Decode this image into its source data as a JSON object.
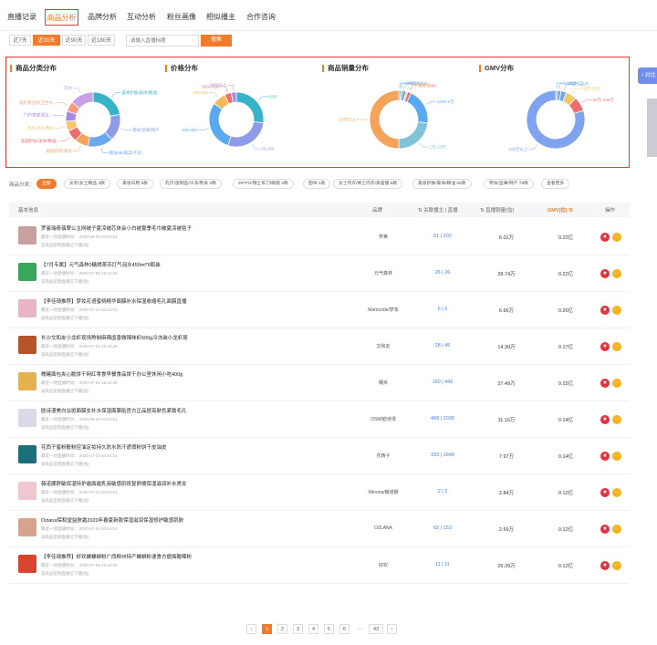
{
  "nav": {
    "tabs": [
      {
        "label": "直播记录"
      },
      {
        "label": "商品分析"
      },
      {
        "label": "品牌分析"
      },
      {
        "label": "互动分析"
      },
      {
        "label": "粉丝画像"
      },
      {
        "label": "相似播主"
      },
      {
        "label": "合作咨询"
      }
    ],
    "active": 1
  },
  "filters": {
    "periods": [
      "近7天",
      "近30天",
      "近90天",
      "近180天"
    ],
    "active": 1,
    "search_placeholder": "请输入直播标题",
    "search_button": "搜索"
  },
  "charts": {
    "category": {
      "title": "商品分类分布",
      "labels": [
        "美妆护肤/美体/精油...",
        "零食/坚果/特产",
        "粮油/米/蔬菜/干货...",
        "服饰内衣/男装",
        "美容护肤/美体/精油...",
        "厨房/烹饪用具",
        "个护/家庭清洁...",
        "洗护清洁剂/卫生巾...",
        "其他"
      ],
      "values": [
        22,
        16,
        15,
        8,
        7,
        6,
        6,
        6,
        14
      ],
      "colors": [
        "#36b3c9",
        "#8f9be8",
        "#6aa9f0",
        "#f4a35b",
        "#ef6d6d",
        "#f6c86b",
        "#a58ae8",
        "#ff9a7a",
        "#c7a0e6"
      ]
    },
    "price": {
      "title": "价格分布",
      "labels": [
        "0-50",
        "50-100",
        "100-300",
        "300-500",
        "500-1000",
        "1000以上"
      ],
      "values": [
        27,
        28,
        30,
        8,
        4,
        3
      ],
      "colors": [
        "#36b3c9",
        "#8f9be8",
        "#5aa8ef",
        "#f6b85b",
        "#ef6d6d",
        "#a58ae8"
      ]
    },
    "sales": {
      "title": "商品销量分布",
      "labels": [
        "0-50",
        "50-100",
        "100-300",
        "300-500",
        "500-1000",
        "1000-1万",
        "1万-10万",
        "10万以上"
      ],
      "values": [
        1,
        1,
        2,
        1,
        2,
        20,
        23,
        50
      ],
      "colors": [
        "#36b3c9",
        "#8f9be8",
        "#6aa9f0",
        "#f6c86b",
        "#ef6d6d",
        "#5aa8ef",
        "#7fc3d8",
        "#f4a35b"
      ]
    },
    "gmv": {
      "title": "GMV分布",
      "labels": [
        "0-1000",
        "1000-1万",
        "1万-10万",
        "10万-50万",
        "50万-100万",
        "100万以上"
      ],
      "values": [
        1,
        2,
        3,
        6,
        8,
        80
      ],
      "colors": [
        "#36b3c9",
        "#8f9be8",
        "#6aa9f0",
        "#f6c86b",
        "#ef6d6d",
        "#7fa3ef"
      ]
    }
  },
  "categories": {
    "label": "商品分类：",
    "items": [
      "全部",
      "女装/女士精品 3款",
      "美妆日用 9款",
      "乳饮/蛋制品/冷冻/熟食 2款",
      "ZIPPO/瑞士军刀/眼镜 2款",
      "图书 1款",
      "女士内衣/男士内衣/家居服 8款",
      "美妆护肤/美体/精油 85款",
      "零食/坚果/特产 79款",
      "查看更多"
    ],
    "active": 0
  },
  "table": {
    "headers": {
      "info": "基本信息",
      "brand": "品牌",
      "relation": "关联播主 | 直播",
      "sales": "直播销量(估)",
      "gmv": "GMV(估)",
      "action": "操作"
    },
    "meta_prefix": "最近一场直播时间：",
    "meta2": "该商品近期直播已下播(估)",
    "rows": [
      {
        "title": "罗曼瑞奇翡翠公主网被子夏凉被芯体会小白被夏季毛巾被夏凉被毯子",
        "time": "2020-06-29 20:54:51",
        "brand": "罗莱",
        "hosts": "51",
        "lives": "202",
        "sales": "6.01万",
        "gmv": "0.22亿",
        "color": "#c8a0a0"
      },
      {
        "title": "【7月专属】元气森林0糖燃茶苏打气泡水450ml*6瓶装",
        "time": "2020-07-08 19:24:29",
        "brand": "元气森林",
        "hosts": "26",
        "lives": "26",
        "sales": "28.74万",
        "gmv": "0.22亿",
        "color": "#3aa55c"
      },
      {
        "title": "【李佳琦推荐】梦妆花语蜜桃精华面膜补水保湿收缩毛孔面膜直播",
        "time": "2020-07-14 20:13:01",
        "brand": "Mamonde/梦妆",
        "hosts": "6",
        "lives": "6",
        "sales": "6.66万",
        "gmv": "0.20亿",
        "color": "#e8b5c8"
      },
      {
        "title": "长沙文和友小龙虾现场熬制麻辣卤香微辣味虾600g冷冻装小龙虾尾",
        "time": "2020-07-03 19:24:29",
        "brand": "文和友",
        "hosts": "28",
        "lives": "45",
        "sales": "14.30万",
        "gmv": "0.17亿",
        "color": "#b5532a"
      },
      {
        "title": "糯曦面包夹心脆饼干网红零食早餐食品饼干办公室休闲小吃400g",
        "time": "2020-07-06 19:24:29",
        "brand": "糯米",
        "hosts": "160",
        "lives": "442",
        "sales": "37.49万",
        "gmv": "0.15亿",
        "color": "#e6b24f"
      },
      {
        "title": "欧诗漫美白淡斑面膜女补水保湿面膜贴官方正品提亮肤色紧致毛孔",
        "time": "2020-06-29 20:54:51",
        "brand": "OSM/欧诗漫",
        "hosts": "468",
        "lives": "2030",
        "sales": "11.16万",
        "gmv": "0.14亿",
        "color": "#d9d9e8"
      },
      {
        "title": "花西子蜜粉散粉控油定妆持久防水防汗遮瑕粉饼干皮油皮",
        "time": "2020-07-10 20:54:51",
        "brand": "花西子",
        "hosts": "333",
        "lives": "1849",
        "sales": "7.97万",
        "gmv": "0.14亿",
        "color": "#1c6e7a"
      },
      {
        "title": "薇诺娜舒敏保湿特护霜面霜乳液敏感肌修复舒缓保湿滋润补水男女",
        "time": "2020-07-12 20:54:51",
        "brand": "Winona/薇诺娜",
        "hosts": "2",
        "lives": "2",
        "sales": "2.84万",
        "gmv": "0.12亿",
        "color": "#f0c7cf"
      },
      {
        "title": "Ozlana保和堂益肤霜2020年春夏新款保湿滋润保湿修护敏感肌肤",
        "time": "2020-07-04 20:54:51",
        "brand": "OZLANA",
        "hosts": "62",
        "lives": "153",
        "sales": "2.69万",
        "gmv": "0.12亿",
        "color": "#d6a48c"
      },
      {
        "title": "【李佳琦推荐】好欢螺螺蛳粉广西柳州特产螺蛳粉速食方便面酸辣粉",
        "time": "2020-07-08 19:24:29",
        "brand": "好欢",
        "hosts": "11",
        "lives": "11",
        "sales": "26.39万",
        "gmv": "0.12亿",
        "color": "#d9442f"
      }
    ]
  },
  "pager": {
    "prev": "‹",
    "next": "›",
    "pages": [
      "1",
      "2",
      "3",
      "4",
      "5",
      "6",
      "…",
      "43"
    ],
    "active": 0
  },
  "side": {
    "label": "对比"
  }
}
